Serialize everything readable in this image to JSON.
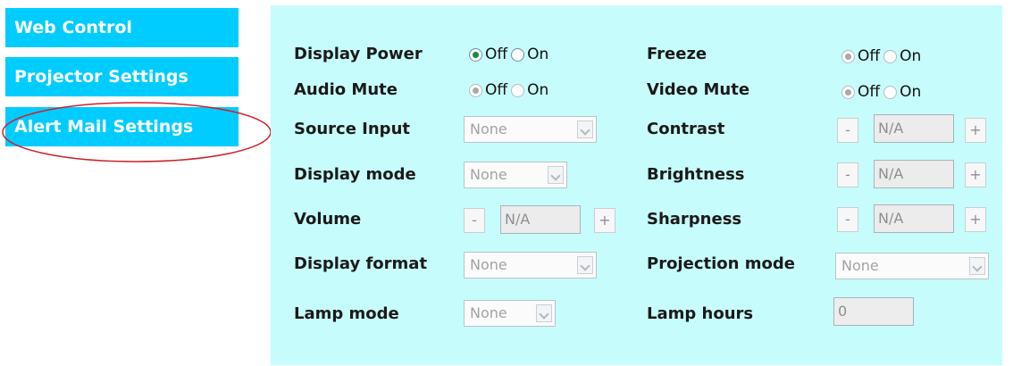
{
  "sidebar": {
    "items": [
      {
        "label": "Web Control"
      },
      {
        "label": "Projector Settings"
      },
      {
        "label": "Alert Mail Settings"
      }
    ]
  },
  "controls": {
    "display_power": {
      "label": "Display Power",
      "options": [
        "Off",
        "On"
      ],
      "selected": "Off"
    },
    "audio_mute": {
      "label": "Audio Mute",
      "options": [
        "Off",
        "On"
      ],
      "selected": "Off"
    },
    "freeze": {
      "label": "Freeze",
      "options": [
        "Off",
        "On"
      ],
      "selected": "Off"
    },
    "video_mute": {
      "label": "Video Mute",
      "options": [
        "Off",
        "On"
      ],
      "selected": "Off"
    },
    "source_input": {
      "label": "Source Input",
      "value": "None"
    },
    "display_mode": {
      "label": "Display mode",
      "value": "None"
    },
    "volume": {
      "label": "Volume",
      "value": "N/A",
      "minus": "-",
      "plus": "+"
    },
    "display_format": {
      "label": "Display format",
      "value": "None"
    },
    "lamp_mode": {
      "label": "Lamp mode",
      "value": "None"
    },
    "contrast": {
      "label": "Contrast",
      "value": "N/A",
      "minus": "-",
      "plus": "+"
    },
    "brightness": {
      "label": "Brightness",
      "value": "N/A",
      "minus": "-",
      "plus": "+"
    },
    "sharpness": {
      "label": "Sharpness",
      "value": "N/A",
      "minus": "-",
      "plus": "+"
    },
    "projection_mode": {
      "label": "Projection mode",
      "value": "None"
    },
    "lamp_hours": {
      "label": "Lamp hours",
      "value": "0"
    }
  },
  "colors": {
    "sidebar_bg": "#00ccff",
    "panel_bg": "#c6fcfc",
    "highlight": "#d0202a"
  }
}
